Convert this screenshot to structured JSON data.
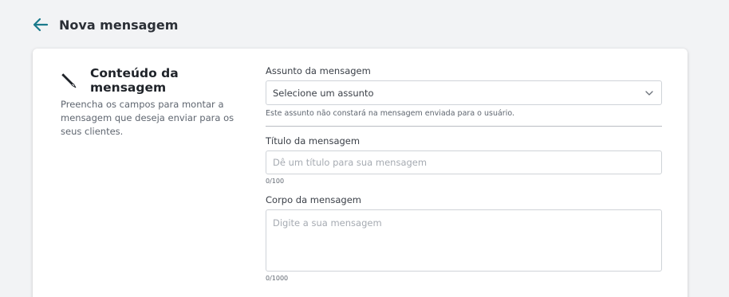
{
  "header": {
    "title": "Nova mensagem",
    "back_icon": "arrow-left-icon",
    "accent_color": "#1b7a8c"
  },
  "section": {
    "icon": "pen-icon",
    "title": "Conteúdo da mensagem",
    "description": "Preencha os campos para montar a mensagem que deseja enviar para os seus clientes."
  },
  "form": {
    "subject": {
      "label": "Assunto da mensagem",
      "value": "Selecione um assunto",
      "helper": "Este assunto não constará na mensagem enviada para o usuário."
    },
    "title": {
      "label": "Título da mensagem",
      "placeholder": "Dê um título para sua mensagem",
      "counter": "0/100"
    },
    "body": {
      "label": "Corpo da mensagem",
      "placeholder": "Digite a sua mensagem",
      "counter": "0/1000"
    }
  }
}
